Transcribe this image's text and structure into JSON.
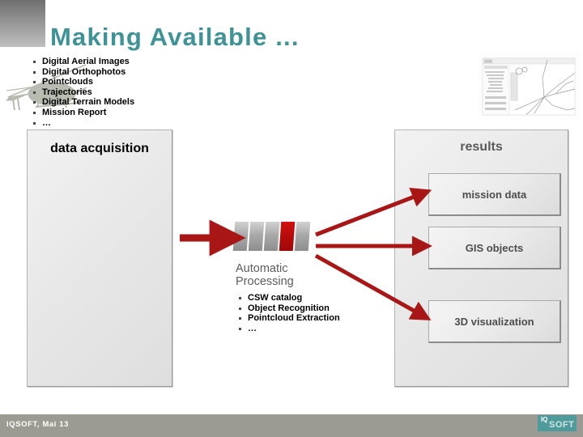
{
  "slide": {
    "title": "Making Available ...",
    "title_color": "#3f9295"
  },
  "decor": {
    "helicopter_icon": "helicopter-silhouette",
    "map_thumbnail": "gis-map-screenshot"
  },
  "left_panel": {
    "heading": "data acquisition",
    "bullets": [
      "Digital Aerial Images",
      "Digital Orthophotos",
      "Pointclouds",
      "Trajectories",
      "Digital Terrain Models",
      "Mission Report",
      "…"
    ]
  },
  "center": {
    "icon_name": "processing-segments-icon",
    "segment_count": 5,
    "highlight_segment_index": 4,
    "highlight_color": "#b80b0b",
    "title": "Automatic Processing",
    "bullets": [
      "CSW catalog",
      "Object Recognition",
      "Pointcloud Extraction",
      "…"
    ]
  },
  "right_panel": {
    "heading": "results",
    "boxes": [
      "mission data",
      "GIS objects",
      "3D visualization"
    ]
  },
  "arrows": {
    "color": "#a81616",
    "items": [
      "arrow-acquisition-to-processing",
      "arrow-processing-to-mission-data",
      "arrow-processing-to-gis-objects",
      "arrow-processing-to-3d-visualization"
    ]
  },
  "footer": {
    "text": "IQSOFT, Mai 13",
    "logo_mark": "IQ",
    "logo_text": "SOFT",
    "bar_color": "#9b9b93",
    "logo_color": "#4f9a9a"
  }
}
